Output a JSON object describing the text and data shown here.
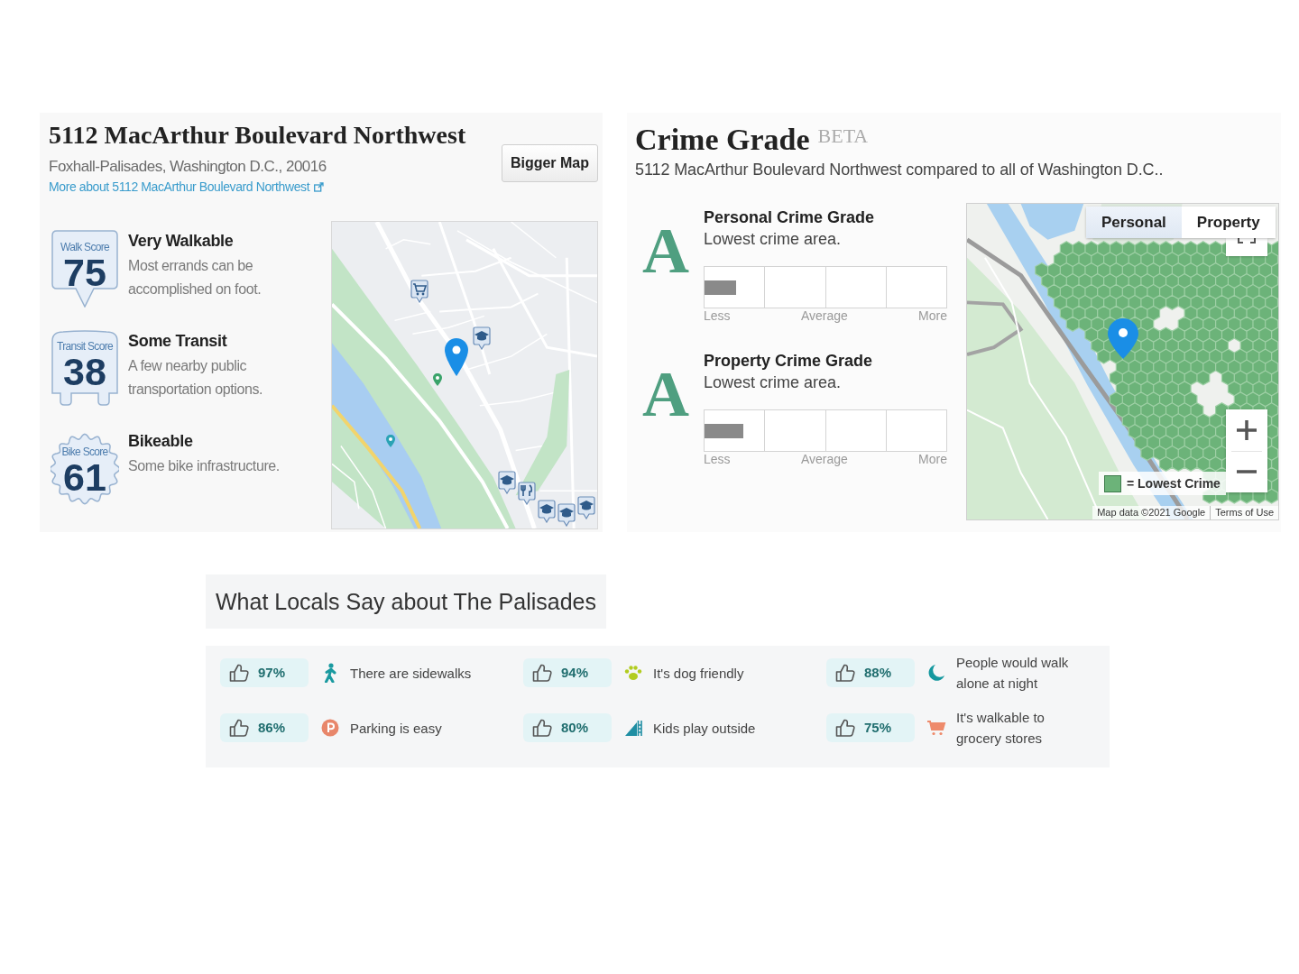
{
  "walkscore": {
    "title": "5112 MacArthur Boulevard Northwest",
    "subtitle": "Foxhall-Palisades, Washington D.C., 20016",
    "link": "More about 5112 MacArthur Boulevard Northwest",
    "button": "Bigger Map",
    "scores": [
      {
        "kind": "walk",
        "label": "Walk Score",
        "value": "75",
        "title": "Very Walkable",
        "description": "Most errands can be accomplished on foot."
      },
      {
        "kind": "transit",
        "label": "Transit Score",
        "value": "38",
        "title": "Some Transit",
        "description": "A few nearby public transportation options."
      },
      {
        "kind": "bike",
        "label": "Bike Score",
        "value": "61",
        "title": "Bikeable",
        "description": "Some bike infrastructure."
      }
    ]
  },
  "crime": {
    "title": "Crime Grade",
    "badge": "BETA",
    "subtitle": "5112 MacArthur Boulevard Northwest compared to all of Washington D.C..",
    "grades": [
      {
        "grade": "A",
        "title": "Personal Crime Grade",
        "description": "Lowest crime area.",
        "level": 0.13,
        "scale": [
          "Less",
          "Average",
          "More"
        ]
      },
      {
        "grade": "A",
        "title": "Property Crime Grade",
        "description": "Lowest crime area.",
        "level": 0.16,
        "scale": [
          "Less",
          "Average",
          "More"
        ]
      }
    ],
    "map": {
      "tabs": [
        {
          "label": "Personal",
          "selected": true
        },
        {
          "label": "Property",
          "selected": false
        }
      ],
      "legend": "= Lowest Crime",
      "attribution": "Map data ©2021 Google",
      "terms": "Terms of Use"
    }
  },
  "locals": {
    "title": "What Locals Say about The Palisades",
    "items": [
      {
        "percent": "97%",
        "kind": "walking",
        "text": "There are sidewalks"
      },
      {
        "percent": "94%",
        "kind": "paw",
        "text": "It's dog friendly"
      },
      {
        "percent": "88%",
        "kind": "moon",
        "text": "People would walk alone at night"
      },
      {
        "percent": "86%",
        "kind": "parking",
        "text": "Parking is easy"
      },
      {
        "percent": "80%",
        "kind": "slide",
        "text": "Kids play outside"
      },
      {
        "percent": "75%",
        "kind": "cart",
        "text": "It's walkable to grocery stores"
      }
    ]
  }
}
